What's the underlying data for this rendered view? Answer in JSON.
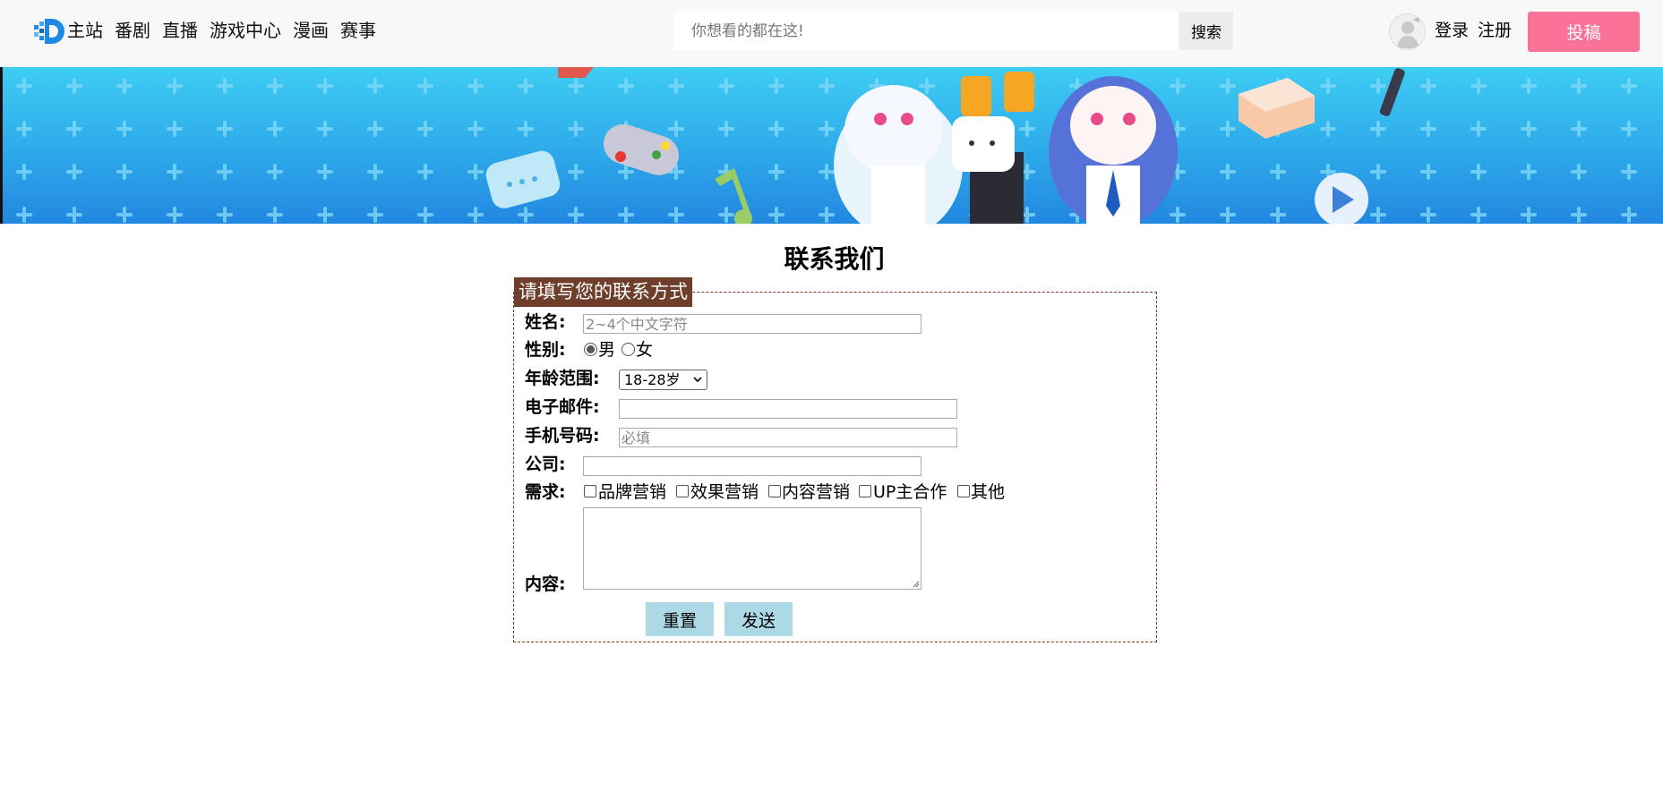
{
  "header": {
    "nav": [
      "主站",
      "番剧",
      "直播",
      "游戏中心",
      "漫画",
      "赛事"
    ],
    "search_placeholder": "你想看的都在这!",
    "search_button": "搜索",
    "login": "登录",
    "register": "注册",
    "upload": "投稿",
    "brand_color": "#fb7299"
  },
  "banner": {
    "icon": "anime-characters-banner"
  },
  "form": {
    "title": "联系我们",
    "legend": "请填写您的联系方式",
    "name_label": "姓名:",
    "name_placeholder": "2~4个中文字符",
    "gender_label": "性别:",
    "gender_options": [
      "男",
      "女"
    ],
    "gender_selected": "男",
    "age_label": "年龄范围:",
    "age_value": "18-28岁",
    "email_label": "电子邮件:",
    "phone_label": "手机号码:",
    "phone_placeholder": "必填",
    "company_label": "公司:",
    "needs_label": "需求:",
    "needs_options": [
      "品牌营销",
      "效果营销",
      "内容营销",
      "UP主合作",
      "其他"
    ],
    "content_label": "内容:",
    "reset_button": "重置",
    "submit_button": "发送"
  }
}
